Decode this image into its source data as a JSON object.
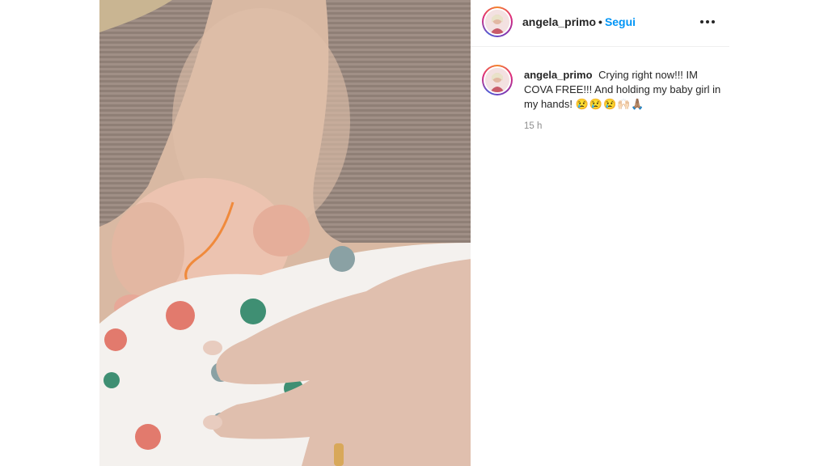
{
  "post": {
    "username": "angela_primo",
    "separator": "•",
    "follow_label": "Segui",
    "more_icon": "ellipsis-icon",
    "caption_username": "angela_primo",
    "caption_text": "Crying right now!!! IM COVA FREE!!! And holding my baby girl in my hands!",
    "caption_emojis": "😢😢😢🙌🏻🙏🏽",
    "timestamp": "15 h"
  },
  "colors": {
    "link_blue": "#0095f6",
    "text": "#262626",
    "secondary": "#8e8e8e"
  }
}
